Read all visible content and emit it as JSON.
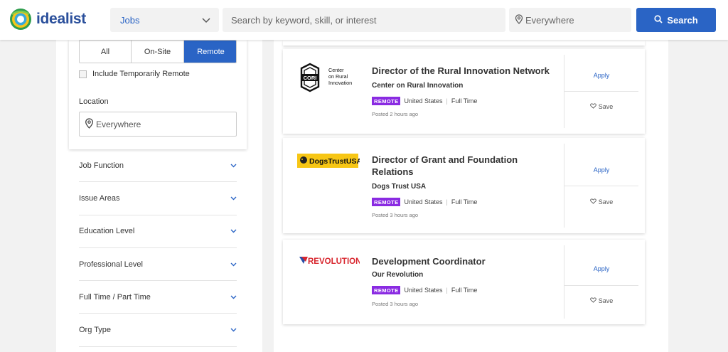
{
  "header": {
    "logo_text": "idealist",
    "category_select": "Jobs",
    "search_placeholder": "Search by keyword, skill, or interest",
    "location_placeholder": "Everywhere",
    "search_button": "Search",
    "brand_color": "#2a64c5"
  },
  "filters": {
    "location_type": {
      "options": [
        "All",
        "On-Site",
        "Remote"
      ],
      "selected": "Remote"
    },
    "include_temporarily_remote": "Include Temporarily Remote",
    "location_label": "Location",
    "location_value": "Everywhere",
    "accordions": [
      "Job Function",
      "Issue Areas",
      "Education Level",
      "Professional Level",
      "Full Time / Part Time",
      "Org Type"
    ]
  },
  "jobs": [
    {
      "title": "Director of the Rural Innovation Network",
      "org": "Center on Rural Innovation",
      "logo_text": [
        "Center",
        "on Rural",
        "Innovation"
      ],
      "logo_mark": "CORI",
      "badge": "REMOTE",
      "location": "United States",
      "type": "Full Time",
      "posted": "Posted 2 hours ago",
      "apply": "Apply",
      "save": "Save"
    },
    {
      "title": "Director of Grant and Foundation Relations",
      "org": "Dogs Trust USA",
      "logo_text": "DogsTrustUSA",
      "badge": "REMOTE",
      "location": "United States",
      "type": "Full Time",
      "posted": "Posted 3 hours ago",
      "apply": "Apply",
      "save": "Save"
    },
    {
      "title": "Development Coordinator",
      "org": "Our Revolution",
      "logo_text": "REVOLUTION",
      "badge": "REMOTE",
      "location": "United States",
      "type": "Full Time",
      "posted": "Posted 3 hours ago",
      "apply": "Apply",
      "save": "Save"
    }
  ],
  "colors": {
    "remote_badge": "#8a2be2",
    "dogs_trust_yellow": "#f7c615",
    "revolution_red": "#d8262e"
  }
}
